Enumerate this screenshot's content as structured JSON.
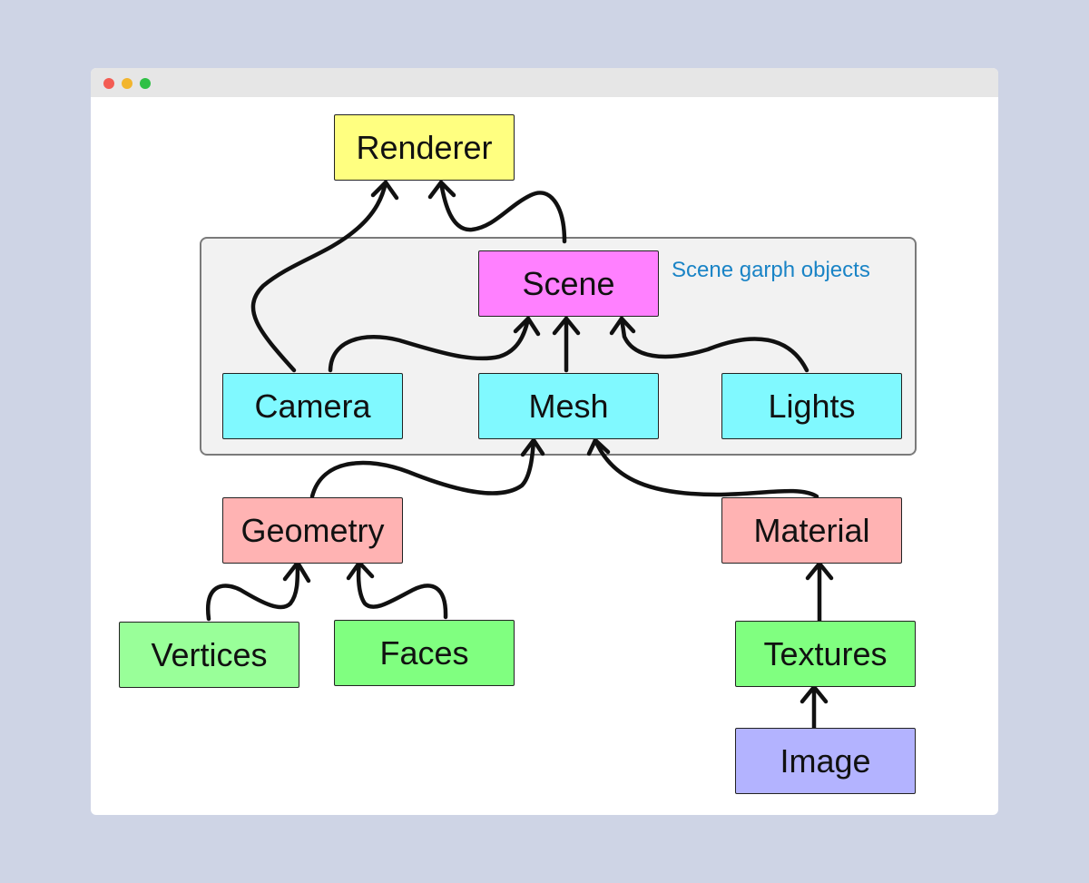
{
  "group": {
    "label": "Scene garph objects"
  },
  "nodes": {
    "renderer": {
      "label": "Renderer",
      "color": "#ffff80"
    },
    "scene": {
      "label": "Scene",
      "color": "#ff80ff"
    },
    "camera": {
      "label": "Camera",
      "color": "#80f9ff"
    },
    "mesh": {
      "label": "Mesh",
      "color": "#80f9ff"
    },
    "lights": {
      "label": "Lights",
      "color": "#80f9ff"
    },
    "geometry": {
      "label": "Geometry",
      "color": "#ffb3b3"
    },
    "material": {
      "label": "Material",
      "color": "#ffb3b3"
    },
    "vertices": {
      "label": "Vertices",
      "color": "#99ff99"
    },
    "faces": {
      "label": "Faces",
      "color": "#80ff80"
    },
    "textures": {
      "label": "Textures",
      "color": "#80ff80"
    },
    "image": {
      "label": "Image",
      "color": "#b3b3ff"
    }
  },
  "edges": [
    {
      "from": "camera",
      "to": "renderer"
    },
    {
      "from": "scene",
      "to": "renderer"
    },
    {
      "from": "camera",
      "to": "scene"
    },
    {
      "from": "mesh",
      "to": "scene"
    },
    {
      "from": "lights",
      "to": "scene"
    },
    {
      "from": "geometry",
      "to": "mesh"
    },
    {
      "from": "material",
      "to": "mesh"
    },
    {
      "from": "vertices",
      "to": "geometry"
    },
    {
      "from": "faces",
      "to": "geometry"
    },
    {
      "from": "textures",
      "to": "material"
    },
    {
      "from": "image",
      "to": "textures"
    }
  ]
}
